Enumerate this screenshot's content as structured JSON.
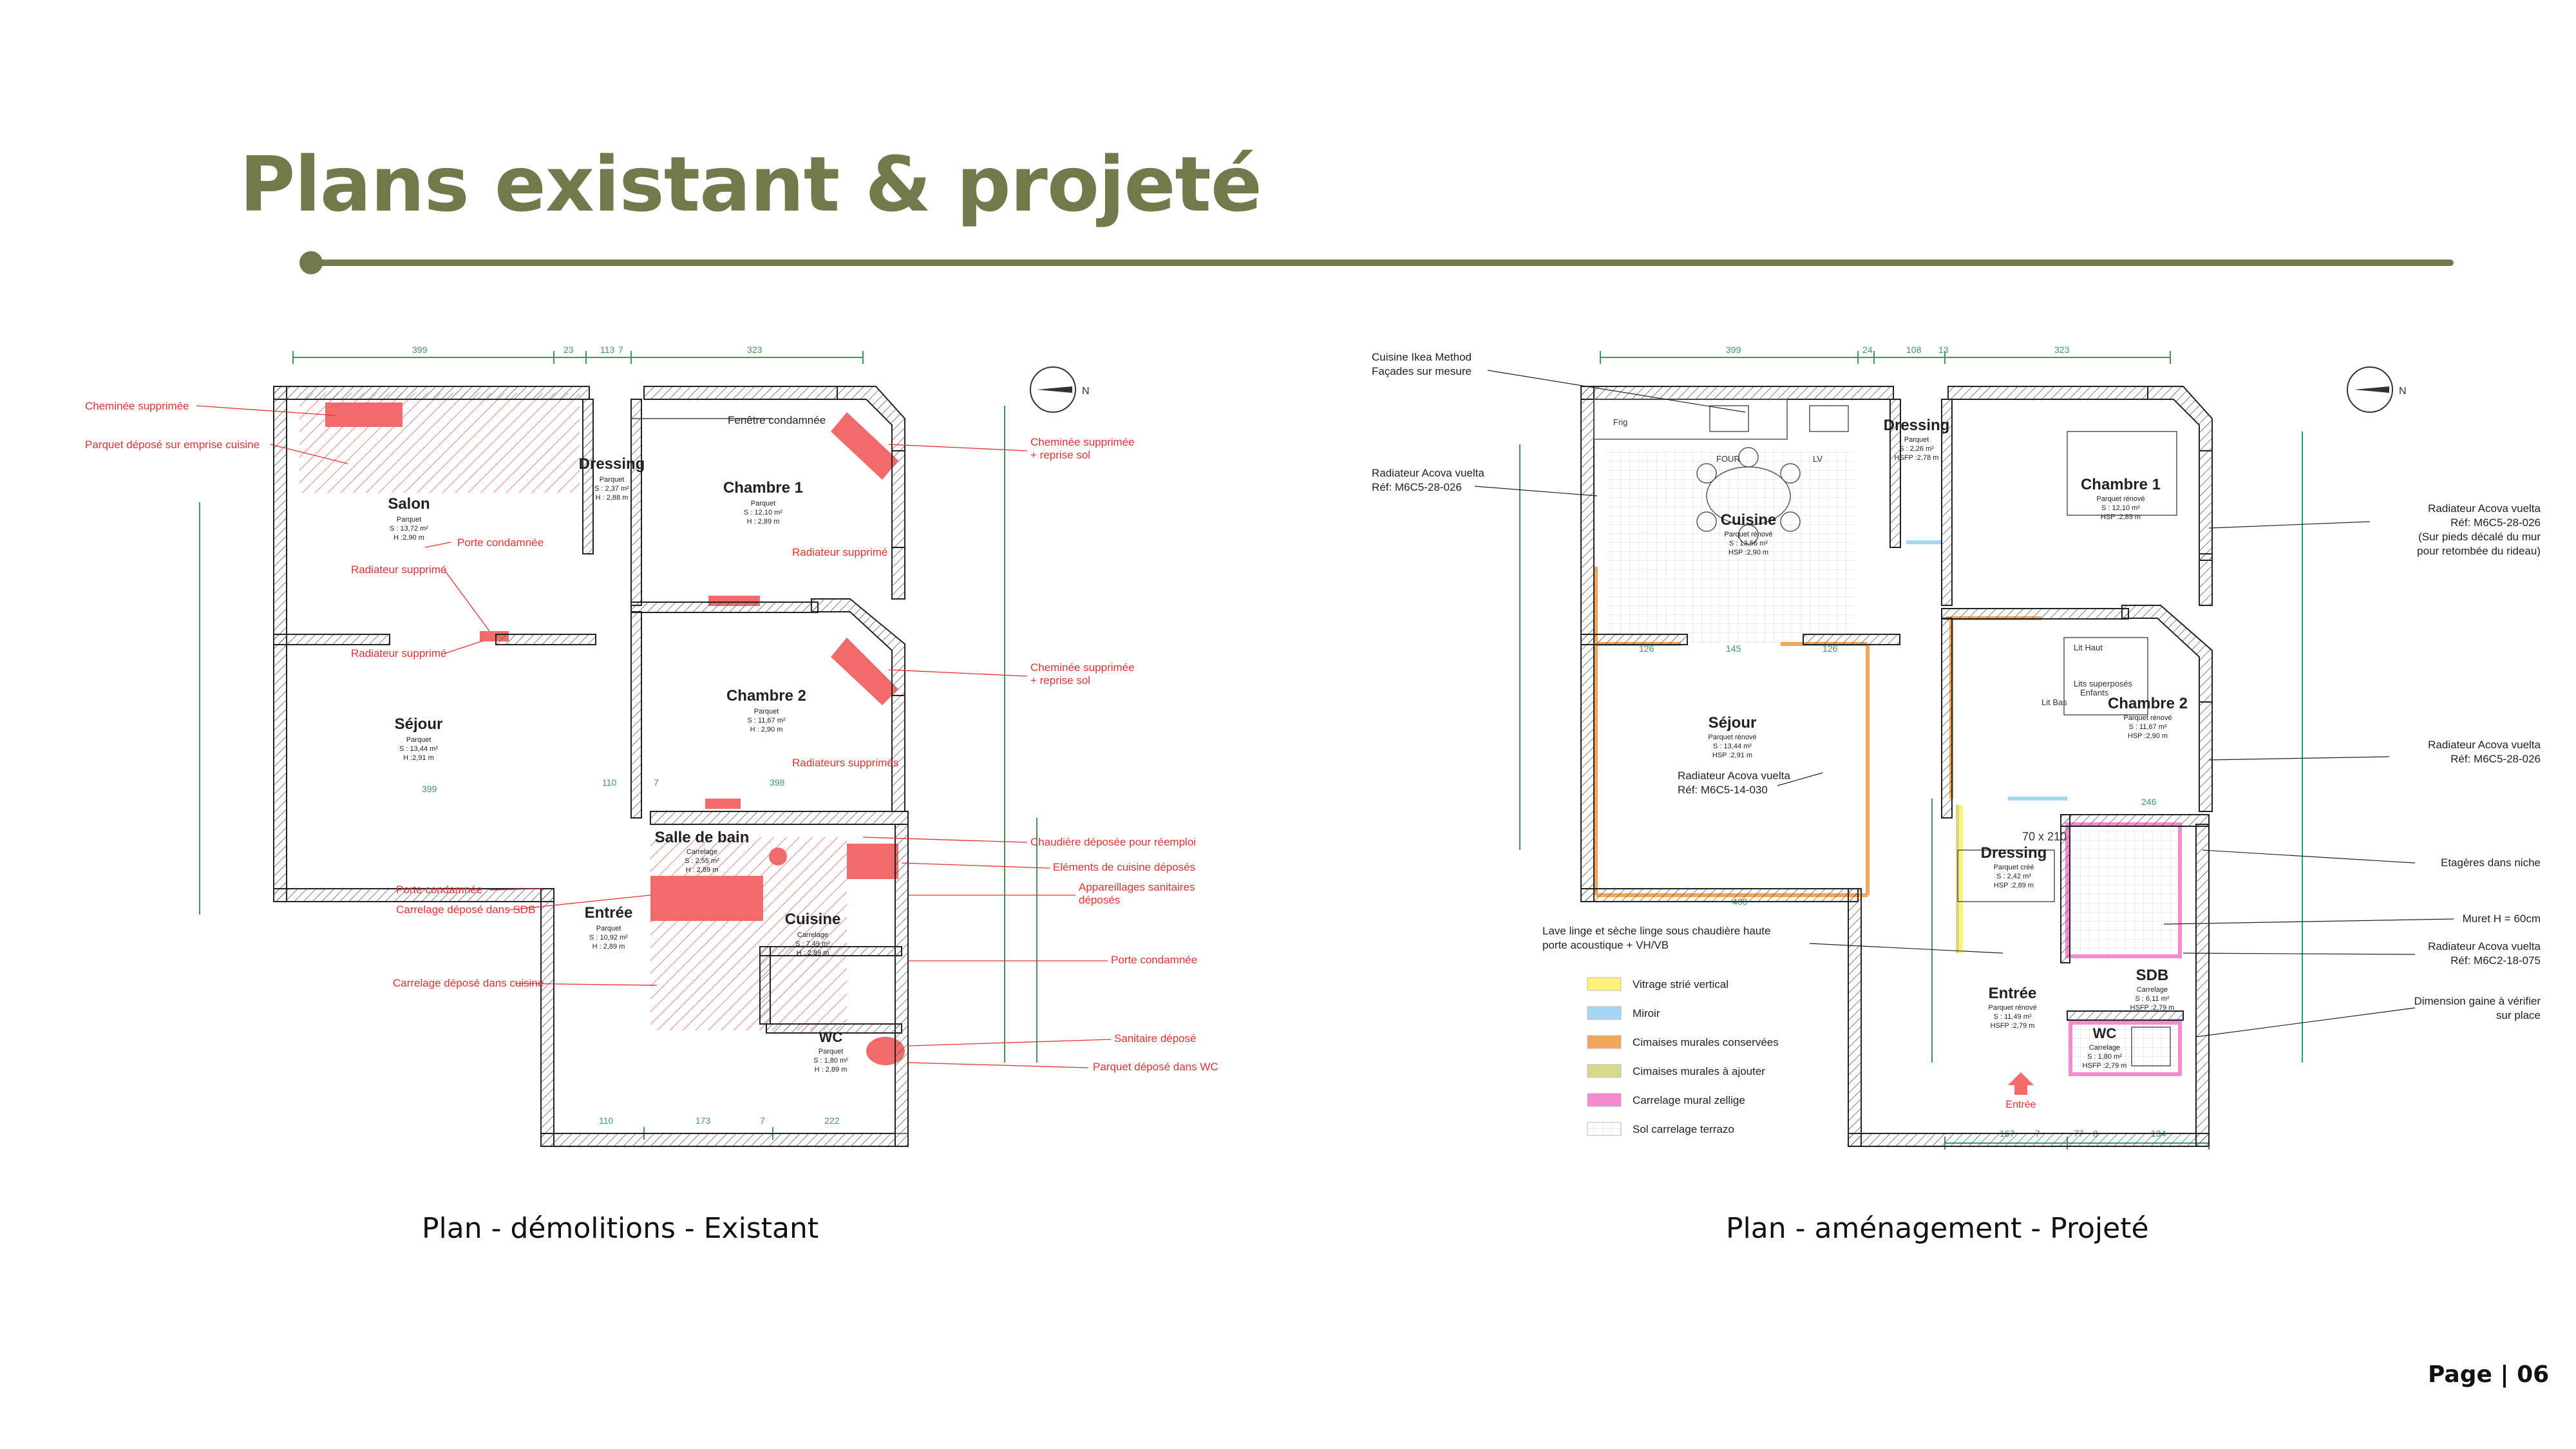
{
  "page": {
    "title": "Plans existant & projeté",
    "page_number": "Page | 06",
    "accent_color": "#727a4c"
  },
  "plan_existing": {
    "caption": "Plan - démolitions - Existant",
    "rooms": [
      {
        "name": "Salon",
        "floor": "Parquet",
        "surface": "S : 13,72 m²",
        "height": "H :2,90 m"
      },
      {
        "name": "Dressing",
        "floor": "Parquet",
        "surface": "S : 2,37 m²",
        "height": "H : 2,88 m"
      },
      {
        "name": "Chambre 1",
        "floor": "Parquet",
        "surface": "S : 12,10 m²",
        "height": "H : 2,89 m"
      },
      {
        "name": "Séjour",
        "floor": "Parquet",
        "surface": "S : 13,44 m²",
        "height": "H :2,91 m"
      },
      {
        "name": "Chambre 2",
        "floor": "Parquet",
        "surface": "S : 11,67 m²",
        "height": "H : 2,90 m"
      },
      {
        "name": "Salle de bain",
        "floor": "Carrelage",
        "surface": "S : 2,55 m²",
        "height": "H : 2,89 m"
      },
      {
        "name": "Entrée",
        "floor": "Parquet",
        "surface": "S : 10,92 m²",
        "height": "H : 2,89 m"
      },
      {
        "name": "Cuisine",
        "floor": "Carrelage",
        "surface": "S : 7,49 m²",
        "height": "H : 2,89 m"
      },
      {
        "name": "WC",
        "floor": "Parquet",
        "surface": "S : 1,80 m²",
        "height": "H : 2,89 m"
      }
    ],
    "annotations_left": [
      "Cheminée supprimée",
      "Parquet déposé sur emprise cuisine",
      "Porte condamnée",
      "Radiateur supprimé",
      "Radiateur supprimé",
      "Porte condamnée",
      "Carrelage déposé dans SDB",
      "Carrelage déposé dans cuisine"
    ],
    "annotations_right": [
      "Cheminée supprimée",
      "+ reprise sol",
      "Radiateur supprimé",
      "Cheminée supprimée",
      "+ reprise sol",
      "Radiateurs supprimés",
      "Chaudière déposée pour réemploi",
      "Eléments de cuisine déposés",
      "Appareillages sanitaires",
      "déposés",
      "Porte condamnée",
      "Sanitaire déposé",
      "Parquet déposé dans WC"
    ],
    "window_note": "Fenêtre condamnée",
    "dimensions_top": [
      "399",
      "23",
      "113",
      "7",
      "323"
    ],
    "dimensions_bottom": [
      "110",
      "173",
      "7",
      "222"
    ],
    "dimensions_inner": [
      "399",
      "110",
      "7",
      "398"
    ]
  },
  "plan_project": {
    "caption": "Plan - aménagement - Projeté",
    "rooms": [
      {
        "name": "Cuisine",
        "floor": "Parquet rénové",
        "surface": "S : 13,56 m²",
        "height": "HSP :2,90 m"
      },
      {
        "name": "Dressing",
        "floor": "Parquet",
        "surface": "S : 2,26 m²",
        "height": "HSFP :2,78 m"
      },
      {
        "name": "Chambre 1",
        "floor": "Parquet rénové",
        "surface": "S : 12,10 m²",
        "height": "HSP :2,89 m"
      },
      {
        "name": "Séjour",
        "floor": "Parquet rénové",
        "surface": "S : 13,44 m²",
        "height": "HSP :2,91 m"
      },
      {
        "name": "Chambre 2",
        "floor": "Parquet rénové",
        "surface": "S : 11,67 m²",
        "height": "HSP :2,90 m"
      },
      {
        "name": "Dressing",
        "floor": "Parquet créé",
        "surface": "S : 2,42 m²",
        "height": "HSP :2,89 m"
      },
      {
        "name": "Entrée",
        "floor": "Parquet rénové",
        "surface": "S : 11,49 m²",
        "height": "HSFP :2,79 m"
      },
      {
        "name": "SDB",
        "floor": "Carrelage",
        "surface": "S : 6,11 m²",
        "height": "HSFP :2,79 m"
      },
      {
        "name": "WC",
        "floor": "Carrelage",
        "surface": "S : 1,80 m²",
        "height": "HSFP :2,79 m"
      }
    ],
    "fixtures": [
      "Frig",
      "FOUR",
      "LV",
      "Lit Haut",
      "Lits superposés",
      "Enfants",
      "Lit Bas",
      "70 x 210",
      "Entrée"
    ],
    "annotations_left": [
      "Cuisine Ikea Method",
      "Façades sur mesure",
      "Radiateur Acova vuelta",
      "Réf: M6C5-28-026",
      "Radiateur Acova vuelta",
      "Réf: M6C5-14-030",
      "Lave linge et sèche linge sous chaudière haute",
      "porte acoustique + VH/VB"
    ],
    "annotations_right": [
      "Radiateur Acova vuelta",
      "Réf: M6C5-28-026",
      "(Sur pieds décalé du mur",
      "pour retombée du rideau)",
      "Radiateur Acova vuelta",
      "Réf: M6C5-28-026",
      "Etagères dans niche",
      "Muret H = 60cm",
      "Radiateur Acova vuelta",
      "Réf: M6C2-18-075",
      "Dimension gaine à vérifier",
      "sur place"
    ],
    "legend": [
      {
        "label": "Vitrage strié vertical",
        "color": "#fff27a"
      },
      {
        "label": "Miroir",
        "color": "#a8d4f5"
      },
      {
        "label": "Cimaises murales conservées",
        "color": "#f2a65a"
      },
      {
        "label": "Cimaises murales à ajouter",
        "color": "#d6d98a"
      },
      {
        "label": "Carrelage mural zellige",
        "color": "#f58ad0"
      },
      {
        "label": "Sol carrelage terrazo",
        "color": "#ffffff"
      }
    ],
    "dimensions_top": [
      "399",
      "24",
      "108",
      "13",
      "323"
    ],
    "dimensions_bottom": [
      "167",
      "7",
      "77",
      "8",
      "134"
    ],
    "dimensions_inner": [
      "126",
      "145",
      "126",
      "400",
      "246"
    ]
  }
}
